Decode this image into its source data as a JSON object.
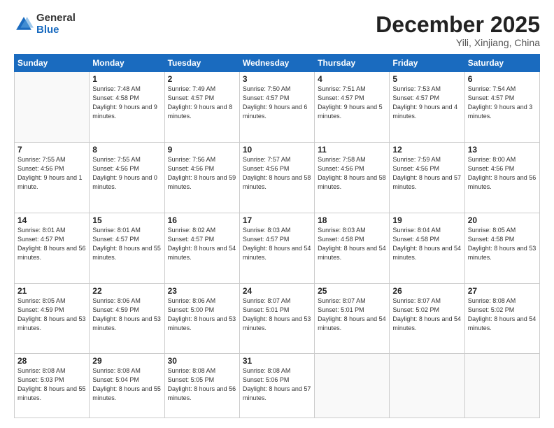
{
  "logo": {
    "general": "General",
    "blue": "Blue"
  },
  "header": {
    "month": "December 2025",
    "location": "Yili, Xinjiang, China"
  },
  "days_of_week": [
    "Sunday",
    "Monday",
    "Tuesday",
    "Wednesday",
    "Thursday",
    "Friday",
    "Saturday"
  ],
  "weeks": [
    [
      {
        "day": "",
        "sunrise": "",
        "sunset": "",
        "daylight": ""
      },
      {
        "day": "1",
        "sunrise": "Sunrise: 7:48 AM",
        "sunset": "Sunset: 4:58 PM",
        "daylight": "Daylight: 9 hours and 9 minutes."
      },
      {
        "day": "2",
        "sunrise": "Sunrise: 7:49 AM",
        "sunset": "Sunset: 4:57 PM",
        "daylight": "Daylight: 9 hours and 8 minutes."
      },
      {
        "day": "3",
        "sunrise": "Sunrise: 7:50 AM",
        "sunset": "Sunset: 4:57 PM",
        "daylight": "Daylight: 9 hours and 6 minutes."
      },
      {
        "day": "4",
        "sunrise": "Sunrise: 7:51 AM",
        "sunset": "Sunset: 4:57 PM",
        "daylight": "Daylight: 9 hours and 5 minutes."
      },
      {
        "day": "5",
        "sunrise": "Sunrise: 7:53 AM",
        "sunset": "Sunset: 4:57 PM",
        "daylight": "Daylight: 9 hours and 4 minutes."
      },
      {
        "day": "6",
        "sunrise": "Sunrise: 7:54 AM",
        "sunset": "Sunset: 4:57 PM",
        "daylight": "Daylight: 9 hours and 3 minutes."
      }
    ],
    [
      {
        "day": "7",
        "sunrise": "Sunrise: 7:55 AM",
        "sunset": "Sunset: 4:56 PM",
        "daylight": "Daylight: 9 hours and 1 minute."
      },
      {
        "day": "8",
        "sunrise": "Sunrise: 7:55 AM",
        "sunset": "Sunset: 4:56 PM",
        "daylight": "Daylight: 9 hours and 0 minutes."
      },
      {
        "day": "9",
        "sunrise": "Sunrise: 7:56 AM",
        "sunset": "Sunset: 4:56 PM",
        "daylight": "Daylight: 8 hours and 59 minutes."
      },
      {
        "day": "10",
        "sunrise": "Sunrise: 7:57 AM",
        "sunset": "Sunset: 4:56 PM",
        "daylight": "Daylight: 8 hours and 58 minutes."
      },
      {
        "day": "11",
        "sunrise": "Sunrise: 7:58 AM",
        "sunset": "Sunset: 4:56 PM",
        "daylight": "Daylight: 8 hours and 58 minutes."
      },
      {
        "day": "12",
        "sunrise": "Sunrise: 7:59 AM",
        "sunset": "Sunset: 4:56 PM",
        "daylight": "Daylight: 8 hours and 57 minutes."
      },
      {
        "day": "13",
        "sunrise": "Sunrise: 8:00 AM",
        "sunset": "Sunset: 4:56 PM",
        "daylight": "Daylight: 8 hours and 56 minutes."
      }
    ],
    [
      {
        "day": "14",
        "sunrise": "Sunrise: 8:01 AM",
        "sunset": "Sunset: 4:57 PM",
        "daylight": "Daylight: 8 hours and 56 minutes."
      },
      {
        "day": "15",
        "sunrise": "Sunrise: 8:01 AM",
        "sunset": "Sunset: 4:57 PM",
        "daylight": "Daylight: 8 hours and 55 minutes."
      },
      {
        "day": "16",
        "sunrise": "Sunrise: 8:02 AM",
        "sunset": "Sunset: 4:57 PM",
        "daylight": "Daylight: 8 hours and 54 minutes."
      },
      {
        "day": "17",
        "sunrise": "Sunrise: 8:03 AM",
        "sunset": "Sunset: 4:57 PM",
        "daylight": "Daylight: 8 hours and 54 minutes."
      },
      {
        "day": "18",
        "sunrise": "Sunrise: 8:03 AM",
        "sunset": "Sunset: 4:58 PM",
        "daylight": "Daylight: 8 hours and 54 minutes."
      },
      {
        "day": "19",
        "sunrise": "Sunrise: 8:04 AM",
        "sunset": "Sunset: 4:58 PM",
        "daylight": "Daylight: 8 hours and 54 minutes."
      },
      {
        "day": "20",
        "sunrise": "Sunrise: 8:05 AM",
        "sunset": "Sunset: 4:58 PM",
        "daylight": "Daylight: 8 hours and 53 minutes."
      }
    ],
    [
      {
        "day": "21",
        "sunrise": "Sunrise: 8:05 AM",
        "sunset": "Sunset: 4:59 PM",
        "daylight": "Daylight: 8 hours and 53 minutes."
      },
      {
        "day": "22",
        "sunrise": "Sunrise: 8:06 AM",
        "sunset": "Sunset: 4:59 PM",
        "daylight": "Daylight: 8 hours and 53 minutes."
      },
      {
        "day": "23",
        "sunrise": "Sunrise: 8:06 AM",
        "sunset": "Sunset: 5:00 PM",
        "daylight": "Daylight: 8 hours and 53 minutes."
      },
      {
        "day": "24",
        "sunrise": "Sunrise: 8:07 AM",
        "sunset": "Sunset: 5:01 PM",
        "daylight": "Daylight: 8 hours and 53 minutes."
      },
      {
        "day": "25",
        "sunrise": "Sunrise: 8:07 AM",
        "sunset": "Sunset: 5:01 PM",
        "daylight": "Daylight: 8 hours and 54 minutes."
      },
      {
        "day": "26",
        "sunrise": "Sunrise: 8:07 AM",
        "sunset": "Sunset: 5:02 PM",
        "daylight": "Daylight: 8 hours and 54 minutes."
      },
      {
        "day": "27",
        "sunrise": "Sunrise: 8:08 AM",
        "sunset": "Sunset: 5:02 PM",
        "daylight": "Daylight: 8 hours and 54 minutes."
      }
    ],
    [
      {
        "day": "28",
        "sunrise": "Sunrise: 8:08 AM",
        "sunset": "Sunset: 5:03 PM",
        "daylight": "Daylight: 8 hours and 55 minutes."
      },
      {
        "day": "29",
        "sunrise": "Sunrise: 8:08 AM",
        "sunset": "Sunset: 5:04 PM",
        "daylight": "Daylight: 8 hours and 55 minutes."
      },
      {
        "day": "30",
        "sunrise": "Sunrise: 8:08 AM",
        "sunset": "Sunset: 5:05 PM",
        "daylight": "Daylight: 8 hours and 56 minutes."
      },
      {
        "day": "31",
        "sunrise": "Sunrise: 8:08 AM",
        "sunset": "Sunset: 5:06 PM",
        "daylight": "Daylight: 8 hours and 57 minutes."
      },
      {
        "day": "",
        "sunrise": "",
        "sunset": "",
        "daylight": ""
      },
      {
        "day": "",
        "sunrise": "",
        "sunset": "",
        "daylight": ""
      },
      {
        "day": "",
        "sunrise": "",
        "sunset": "",
        "daylight": ""
      }
    ]
  ]
}
